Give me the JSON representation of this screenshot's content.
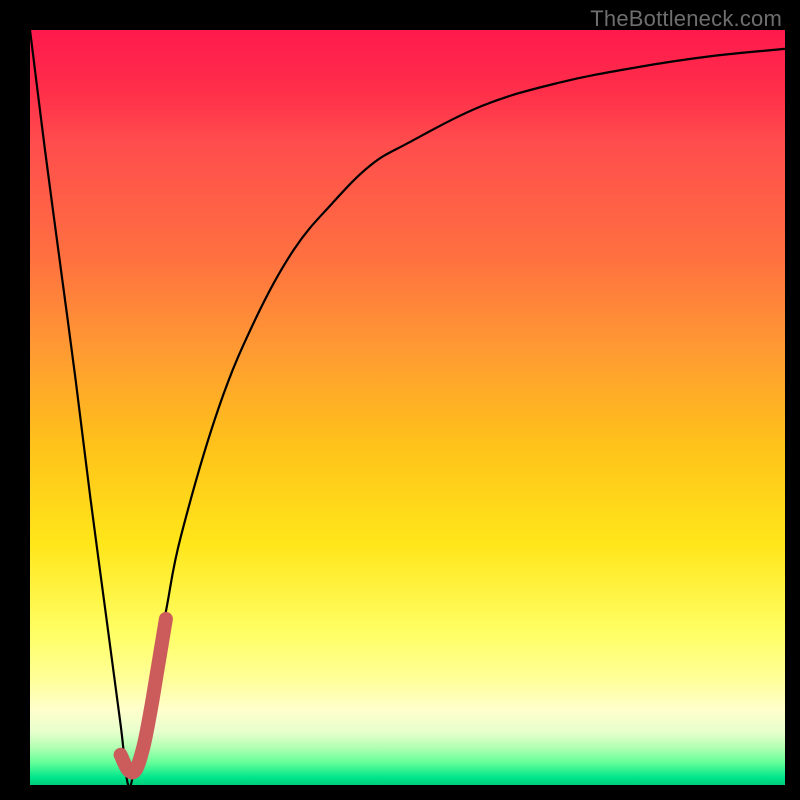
{
  "watermark": "TheBottleneck.com",
  "chart_data": {
    "type": "line",
    "title": "",
    "xlabel": "",
    "ylabel": "",
    "xlim": [
      0,
      100
    ],
    "ylim": [
      0,
      100
    ],
    "series": [
      {
        "name": "bottleneck-curve",
        "color": "#000000",
        "x": [
          0,
          2,
          4,
          6,
          8,
          10,
          12,
          13,
          14,
          16,
          18,
          20,
          25,
          30,
          35,
          40,
          45,
          50,
          60,
          70,
          80,
          90,
          100
        ],
        "y": [
          100,
          84,
          69,
          54,
          38,
          23,
          8,
          0,
          3,
          13,
          23,
          33,
          50,
          62,
          71,
          77,
          82,
          85,
          90,
          93,
          95,
          96.5,
          97.5
        ]
      },
      {
        "name": "optimal-marker",
        "color": "#cc5c5c",
        "x": [
          12,
          13,
          14,
          15,
          16,
          17,
          18
        ],
        "y": [
          4,
          2,
          2,
          5,
          10,
          16,
          22
        ]
      }
    ]
  }
}
